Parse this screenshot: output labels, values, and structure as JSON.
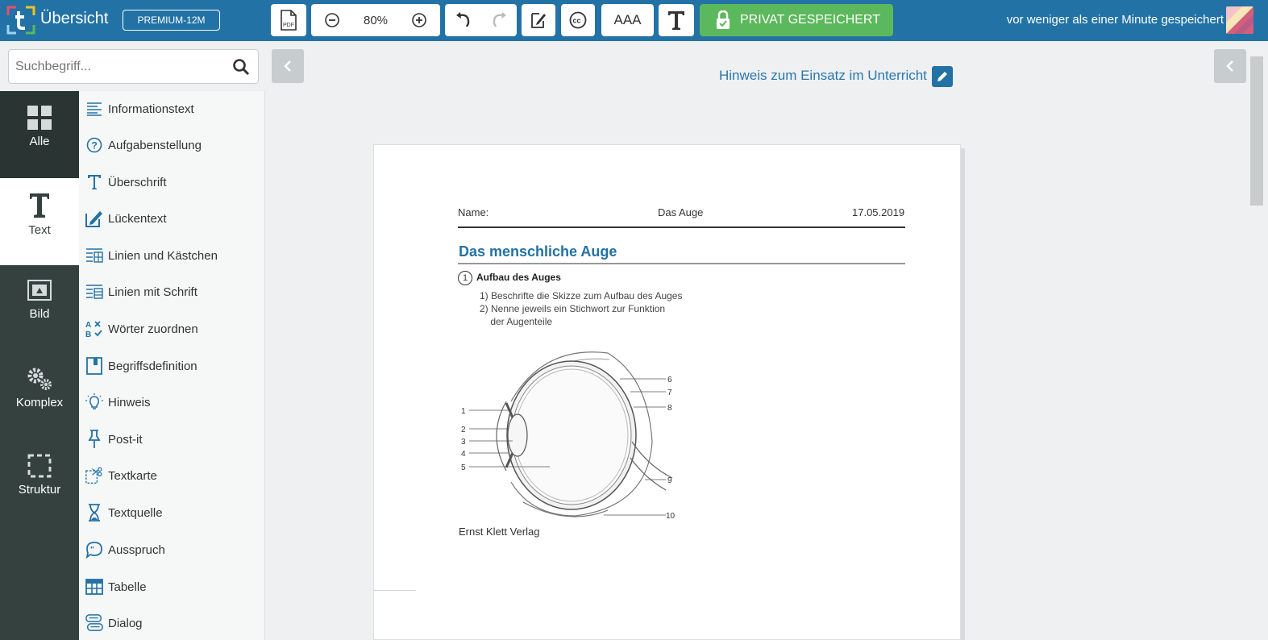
{
  "header": {
    "title": "Übersicht",
    "badge": "PREMIUM-12M",
    "zoom": "80%",
    "font_size_label": "AAA",
    "privacy_label": "PRIVAT GESPEICHERT",
    "saved_status": "vor weniger als einer Minute gespeichert"
  },
  "search": {
    "placeholder": "Suchbegriff..."
  },
  "categories": [
    {
      "label": "Alle",
      "icon": "grid-icon"
    },
    {
      "label": "Text",
      "icon": "text-t-icon"
    },
    {
      "label": "Bild",
      "icon": "image-icon"
    },
    {
      "label": "Komplex",
      "icon": "gears-icon"
    },
    {
      "label": "Struktur",
      "icon": "dashed-square-icon"
    }
  ],
  "items": [
    {
      "label": "Informationstext",
      "icon": "lines-icon"
    },
    {
      "label": "Aufgabenstellung",
      "icon": "question-circle-icon"
    },
    {
      "label": "Überschrift",
      "icon": "heading-t-icon"
    },
    {
      "label": "Lückentext",
      "icon": "edit-box-icon"
    },
    {
      "label": "Linien und Kästchen",
      "icon": "lines-boxes-icon"
    },
    {
      "label": "Linien mit Schrift",
      "icon": "lines-text-icon"
    },
    {
      "label": "Wörter zuordnen",
      "icon": "match-words-icon"
    },
    {
      "label": "Begriffsdefinition",
      "icon": "book-icon"
    },
    {
      "label": "Hinweis",
      "icon": "lightbulb-icon"
    },
    {
      "label": "Post-it",
      "icon": "pin-icon"
    },
    {
      "label": "Textkarte",
      "icon": "scissors-card-icon"
    },
    {
      "label": "Textquelle",
      "icon": "hourglass-icon"
    },
    {
      "label": "Ausspruch",
      "icon": "speech-bubble-icon"
    },
    {
      "label": "Tabelle",
      "icon": "table-icon"
    },
    {
      "label": "Dialog",
      "icon": "dialog-icon"
    }
  ],
  "hint": {
    "label": "Hinweis zum Einsatz im Unterricht"
  },
  "document": {
    "name_label": "Name:",
    "topic": "Das Auge",
    "date": "17.05.2019",
    "title": "Das menschliche Auge",
    "task_number": "1",
    "task_title": "Aufbau des Auges",
    "task_lines": [
      "1) Beschrifte die Skizze zum Aufbau des Auges",
      "2) Nenne jeweils ein Stichwort zur Funktion",
      "    der Augenteile"
    ],
    "figure_labels": [
      "1",
      "2",
      "3",
      "4",
      "5",
      "6",
      "7",
      "8",
      "9",
      "10"
    ],
    "credit": "Ernst Klett Verlag"
  },
  "colors": {
    "topbar": "#2272a6",
    "accent_green": "#5cb85c",
    "sidebar_dark": "#34413f",
    "title_blue": "#2272a6"
  }
}
